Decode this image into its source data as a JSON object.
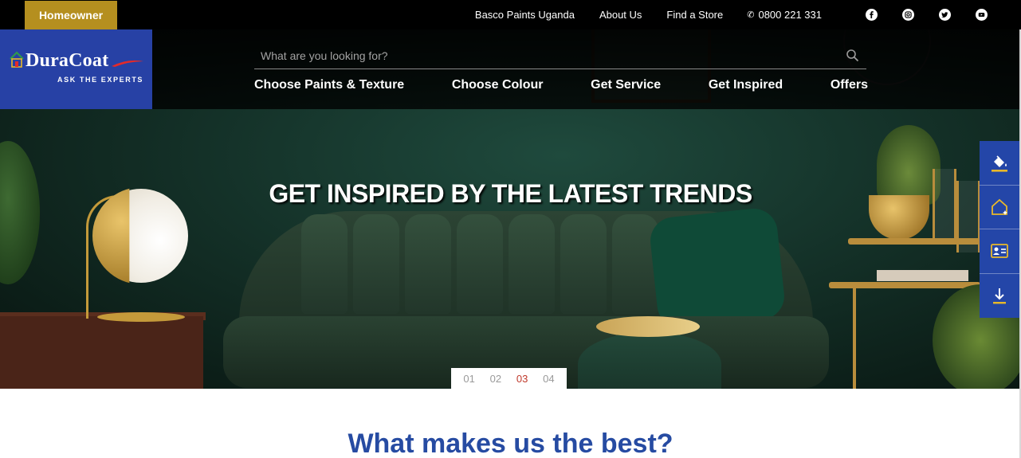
{
  "topbar": {
    "homeowner_label": "Homeowner",
    "links": [
      "Basco Paints Uganda",
      "About Us",
      "Find a Store"
    ],
    "phone": "0800 221 331",
    "socials": [
      "facebook-icon",
      "instagram-icon",
      "twitter-icon",
      "youtube-icon"
    ]
  },
  "logo": {
    "name": "DuraCoat",
    "tagline": "ASK THE EXPERTS",
    "colors": {
      "bg": "#2741a5",
      "swoosh": "#e32a2a",
      "house": "#2e9a4b"
    }
  },
  "search": {
    "placeholder": "What are you looking for?"
  },
  "nav": {
    "items": [
      "Choose Paints & Texture",
      "Choose Colour",
      "Get Service",
      "Get Inspired",
      "Offers"
    ]
  },
  "hero": {
    "title": "GET INSPIRED BY THE LATEST TRENDS",
    "pager": [
      "01",
      "02",
      "03",
      "04"
    ],
    "active_index": 2
  },
  "floating_tools": [
    "paint-bucket-icon",
    "home-sparkle-icon",
    "contact-card-icon",
    "download-icon"
  ],
  "section": {
    "heading": "What makes us the best?"
  },
  "colors": {
    "accent_gold": "#b58f1f",
    "brand_blue": "#2446a8",
    "heading_blue": "#264ba2",
    "active_red": "#c0392b"
  }
}
